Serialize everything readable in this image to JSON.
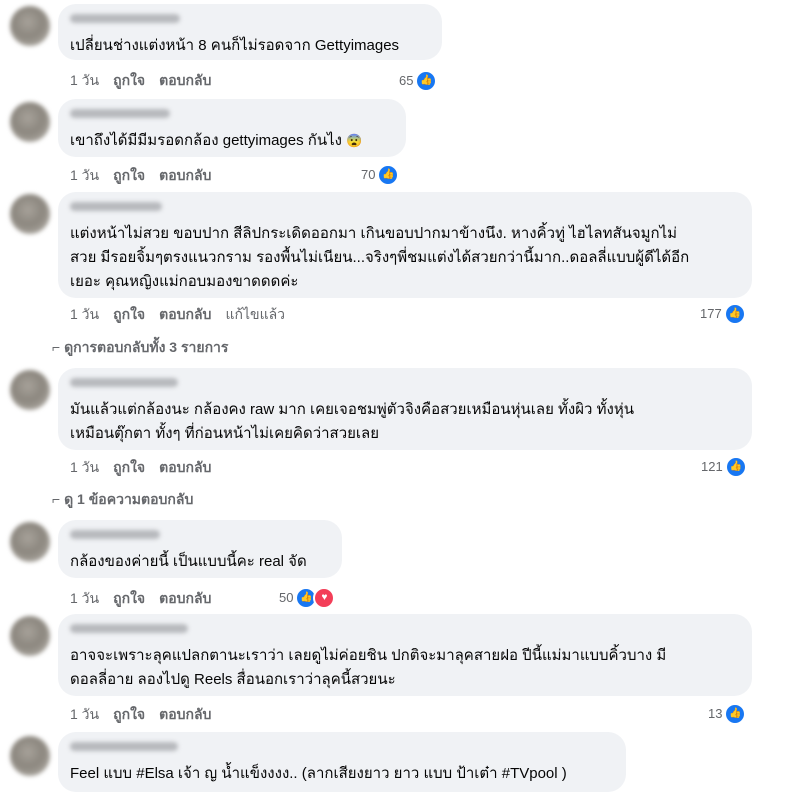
{
  "comments": [
    {
      "text_lines": [
        "เปลี่ยนช่างแต่งหน้า 8 คนก็ไม่รอดจาก Gettyimages"
      ],
      "time": "1 วัน",
      "like_label": "ถูกใจ",
      "reply_label": "ตอบกลับ",
      "reactions": "65"
    },
    {
      "text_lines": [
        "เขาถึงได้มีมีมรอดกล้อง gettyimages กันไง"
      ],
      "emoji": "😨",
      "time": "1 วัน",
      "like_label": "ถูกใจ",
      "reply_label": "ตอบกลับ",
      "reactions": "70"
    },
    {
      "text_lines": [
        "แต่งหน้าไม่สวย ขอบปาก สีลิปกระเดิดออกมา เกินขอบปากมาข้างนึง. หางคิ้วทู่ ไฮไลทสันจมูกไม่",
        "สวย มีรอยจิ้มๆตรงแนวกราม รองพื้นไม่เนียน...จริงๆพี่ชมแต่งได้สวยกว่านี้มาก..ดอลลี่แบบผู้ดีได้อีก",
        "เยอะ คุณหญิงแม่กอบมองขาดดดค่ะ"
      ],
      "time": "1 วัน",
      "like_label": "ถูกใจ",
      "reply_label": "ตอบกลับ",
      "edited_label": "แก้ไขแล้ว",
      "reactions": "177",
      "view_replies": "ดูการตอบกลับทั้ง 3 รายการ"
    },
    {
      "text_lines": [
        "มันแล้วแต่กล้องนะ กล้องคง raw มาก เคยเจอชมพู่ตัวจิงคือสวยเหมือนหุ่นเลย ทั้งผิว ทั้งหุ่น",
        "เหมือนตุ๊กตา ทั้งๆ ที่ก่อนหน้าไม่เคยคิดว่าสวยเลย"
      ],
      "time": "1 วัน",
      "like_label": "ถูกใจ",
      "reply_label": "ตอบกลับ",
      "reactions": "121",
      "view_replies": "ดู 1 ข้อความตอบกลับ"
    },
    {
      "text_lines": [
        "กล้องของค่ายนี้ เป็นแบบนี้คะ real จัด"
      ],
      "time": "1 วัน",
      "like_label": "ถูกใจ",
      "reply_label": "ตอบกลับ",
      "reactions": "50"
    },
    {
      "text_lines": [
        "อาจจะเพราะลุคแปลกตานะเราว่า เลยดูไม่ค่อยชิน ปกติจะมาลุคสายฝอ ปีนี้แม่มาแบบคิ้วบาง มี",
        "ดอลลี่อาย ลองไปดู Reels สื่อนอกเราว่าลุคนี้สวยนะ"
      ],
      "time": "1 วัน",
      "like_label": "ถูกใจ",
      "reply_label": "ตอบกลับ",
      "reactions": "13"
    },
    {
      "text_lines": [
        "Feel แบบ #Elsa เจ้า ญ น้ำแข็งงงง.. (ลากเสียงยาว ยาว แบบ ป้าเต๋า #TVpool )"
      ]
    }
  ],
  "colors": {
    "like_blue": "#1877f2",
    "love_red": "#f33e58",
    "bubble_bg": "#f0f2f5",
    "meta_gray": "#65676b"
  }
}
